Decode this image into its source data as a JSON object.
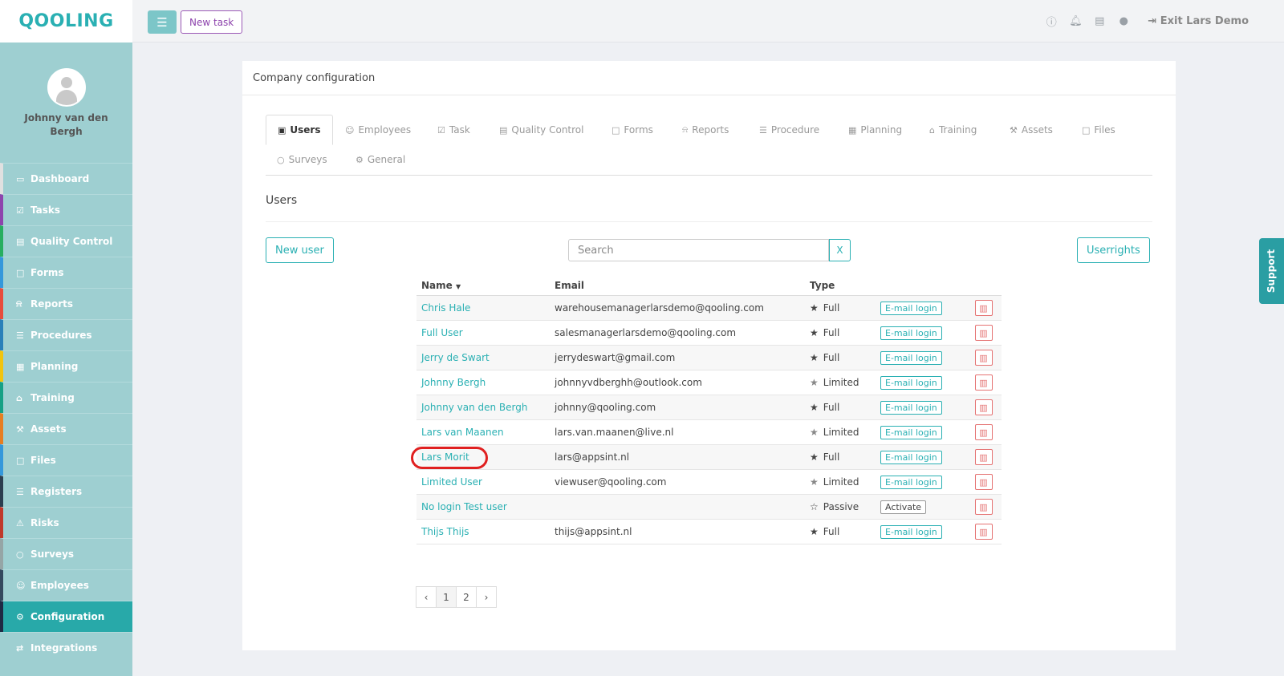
{
  "app": {
    "logo": "QOOLING"
  },
  "topbar": {
    "menu_icon": "hamburger-icon",
    "new_task_label": "New task",
    "icons": [
      "help-icon",
      "bell-icon",
      "book-icon",
      "user-icon"
    ],
    "exit_label": "Exit Lars Demo"
  },
  "profile": {
    "name": "Johnny van den Bergh"
  },
  "sidebar": {
    "items": [
      {
        "label": "Dashboard",
        "icon": "monitor-icon",
        "color": "#e0e0e0"
      },
      {
        "label": "Tasks",
        "icon": "check-square-icon",
        "color": "#8e44ad"
      },
      {
        "label": "Quality Control",
        "icon": "book-icon",
        "color": "#27ae60"
      },
      {
        "label": "Forms",
        "icon": "file-icon",
        "color": "#3498db"
      },
      {
        "label": "Reports",
        "icon": "bell-icon",
        "color": "#e74c3c"
      },
      {
        "label": "Procedures",
        "icon": "list-icon",
        "color": "#2980b9"
      },
      {
        "label": "Planning",
        "icon": "calendar-icon",
        "color": "#f1c40f"
      },
      {
        "label": "Training",
        "icon": "graduation-cap-icon",
        "color": "#16a085"
      },
      {
        "label": "Assets",
        "icon": "wrench-icon",
        "color": "#e67e22"
      },
      {
        "label": "Files",
        "icon": "file-icon",
        "color": "#3498db"
      },
      {
        "label": "Registers",
        "icon": "list-icon",
        "color": "#2c3e50"
      },
      {
        "label": "Risks",
        "icon": "warning-icon",
        "color": "#c0392b"
      },
      {
        "label": "Surveys",
        "icon": "comment-icon",
        "color": "#95a5a6"
      },
      {
        "label": "Employees",
        "icon": "users-icon",
        "color": "#34495e"
      },
      {
        "label": "Configuration",
        "icon": "gear-icon",
        "color": "#1f2a44"
      },
      {
        "label": "Integrations",
        "icon": "exchange-icon",
        "color": "#9ecfd1"
      }
    ]
  },
  "card": {
    "title": "Company configuration",
    "tabs": [
      {
        "label": "Users",
        "icon": "id-card-icon"
      },
      {
        "label": "Employees",
        "icon": "users-icon"
      },
      {
        "label": "Task",
        "icon": "check-square-icon"
      },
      {
        "label": "Quality Control",
        "icon": "book-icon"
      },
      {
        "label": "Forms",
        "icon": "file-icon"
      },
      {
        "label": "Reports",
        "icon": "bell-icon"
      },
      {
        "label": "Procedure",
        "icon": "list-icon"
      },
      {
        "label": "Planning",
        "icon": "calendar-icon"
      },
      {
        "label": "Training",
        "icon": "graduation-cap-icon"
      },
      {
        "label": "Assets",
        "icon": "wrench-icon"
      },
      {
        "label": "Files",
        "icon": "file-icon"
      },
      {
        "label": "Surveys",
        "icon": "comment-icon"
      },
      {
        "label": "General",
        "icon": "gear-icon"
      }
    ],
    "section_title": "Users",
    "new_user_label": "New user",
    "search_placeholder": "Search",
    "search_clear": "X",
    "userrights_label": "Userrights"
  },
  "table": {
    "headers": {
      "name": "Name",
      "email": "Email",
      "type": "Type"
    },
    "rows": [
      {
        "name": "Chris Hale",
        "email": "warehousemanagerlarsdemo@qooling.com",
        "type": "Full",
        "action": "E-mail login"
      },
      {
        "name": "Full User",
        "email": "salesmanagerlarsdemo@qooling.com",
        "type": "Full",
        "action": "E-mail login"
      },
      {
        "name": "Jerry de Swart",
        "email": "jerrydeswart@gmail.com",
        "type": "Full",
        "action": "E-mail login"
      },
      {
        "name": "Johnny Bergh",
        "email": "johnnyvdberghh@outlook.com",
        "type": "Limited",
        "action": "E-mail login"
      },
      {
        "name": "Johnny van den Bergh",
        "email": "johnny@qooling.com",
        "type": "Full",
        "action": "E-mail login"
      },
      {
        "name": "Lars van Maanen",
        "email": "lars.van.maanen@live.nl",
        "type": "Limited",
        "action": "E-mail login"
      },
      {
        "name": "Lars Morit",
        "email": "lars@appsint.nl",
        "type": "Full",
        "action": "E-mail login",
        "highlighted": true
      },
      {
        "name": "Limited User",
        "email": "viewuser@qooling.com",
        "type": "Limited",
        "action": "E-mail login"
      },
      {
        "name": "No login Test user",
        "email": "",
        "type": "Passive",
        "action": "Activate"
      },
      {
        "name": "Thijs Thijs",
        "email": "thijs@appsint.nl",
        "type": "Full",
        "action": "E-mail login"
      }
    ]
  },
  "pagination": {
    "prev": "‹",
    "pages": [
      "1",
      "2"
    ],
    "next": "›",
    "current": "1"
  },
  "support_label": "Support"
}
